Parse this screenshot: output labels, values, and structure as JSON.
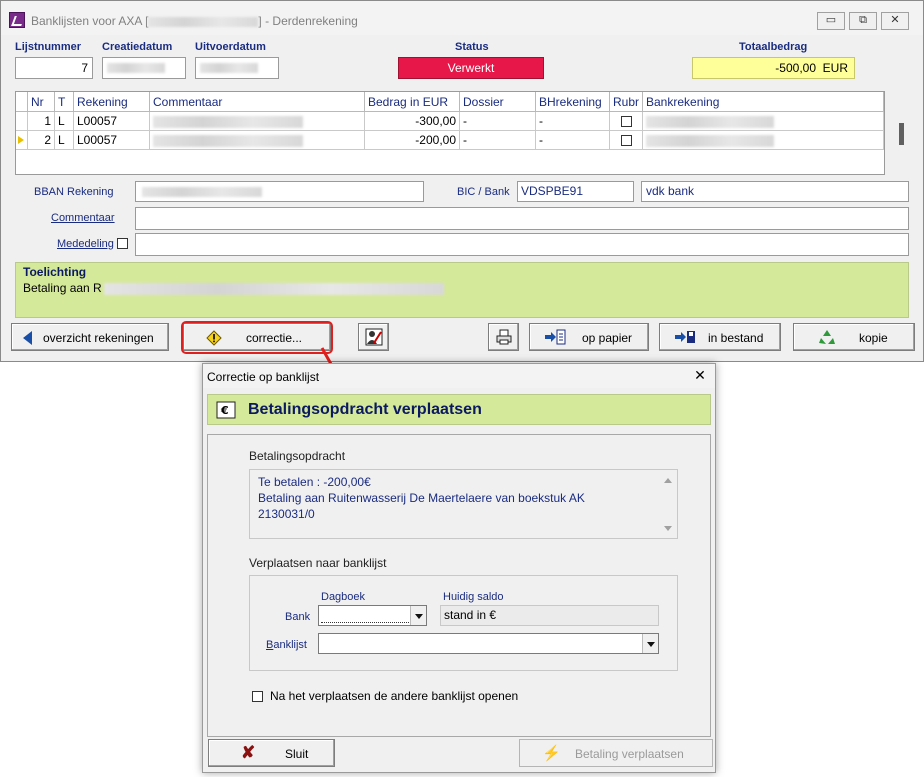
{
  "window": {
    "title_prefix": "Banklijsten voor AXA [",
    "title_suffix": "] - Derdenrekening",
    "minimize": "▭",
    "restore": "⧉",
    "close": "✕"
  },
  "header": {
    "lijstnummer_label": "Lijstnummer",
    "lijstnummer_value": "7",
    "creatiedatum_label": "Creatiedatum",
    "uitvoerdatum_label": "Uitvoerdatum",
    "status_label": "Status",
    "status_value": "Verwerkt",
    "totaalbedrag_label": "Totaalbedrag",
    "totaalbedrag_value": "-500,00  EUR"
  },
  "grid": {
    "columns": [
      "Nr",
      "T",
      "Rekening",
      "Commentaar",
      "Bedrag in EUR",
      "Dossier",
      "BHrekening",
      "Rubr",
      "Bankrekening"
    ],
    "rows": [
      {
        "nr": "1",
        "t": "L",
        "rekening": "L00057",
        "bedrag": "-300,00",
        "dossier": "-",
        "bhrekening": "-"
      },
      {
        "nr": "2",
        "t": "L",
        "rekening": "L00057",
        "bedrag": "-200,00",
        "dossier": "-",
        "bhrekening": "-"
      }
    ]
  },
  "detail": {
    "bban_label": "BBAN Rekening",
    "bic_label": "BIC / Bank",
    "bic_value": "VDSPBE91",
    "bank_value": "vdk bank",
    "commentaar_label": "Commentaar",
    "mededeling_label": "Mededeling",
    "toelichting_title": "Toelichting",
    "toelichting_text": "Betaling aan R"
  },
  "toolbar": {
    "overzicht": "overzicht rekeningen",
    "correctie": "correctie...",
    "op_papier": "op papier",
    "in_bestand": "in bestand",
    "kopie": "kopie"
  },
  "dialog": {
    "title": "Correctie op banklijst",
    "close": "✕",
    "heading": "Betalingsopdracht verplaatsen",
    "section1_title": "Betalingsopdracht",
    "text_line1": "Te betalen : -200,00€",
    "text_line2": "Betaling aan Ruitenwasserij De Maertelaere van boekstuk AK",
    "text_line3": "2130031/0",
    "section2_title": "Verplaatsen naar banklijst",
    "dagboek_label": "Dagboek",
    "huidig_saldo_label": "Huidig saldo",
    "bank_label": "Bank",
    "saldo_value": "stand in €",
    "banklijst_label": "Banklijst",
    "checkbox_label": "Na het verplaatsen de andere banklijst openen",
    "sluit": "Sluit",
    "verplaatsen": "Betaling verplaatsen"
  },
  "colors": {
    "status_red": "#e8174a",
    "total_yellow": "#ffff99",
    "panel_green": "#d5e99a",
    "label_blue": "#1a2c80",
    "highlight_red": "#e0201e"
  }
}
